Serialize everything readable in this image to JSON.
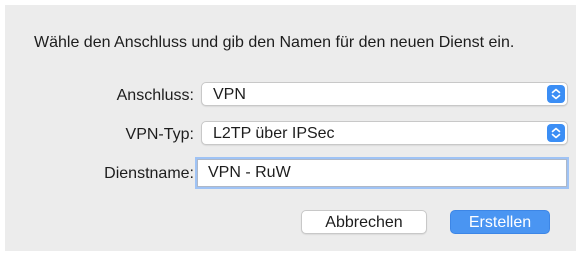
{
  "dialog": {
    "message": "Wähle den Anschluss und gib den Namen für den neuen Dienst ein.",
    "interface": {
      "label": "Anschluss:",
      "value": "VPN"
    },
    "vpn_type": {
      "label": "VPN-Typ:",
      "value": "L2TP über IPSec"
    },
    "service_name": {
      "label": "Dienstname:",
      "value": "VPN - RuW"
    },
    "buttons": {
      "cancel": "Abbrechen",
      "create": "Erstellen"
    }
  },
  "colors": {
    "accent": "#4a95f2",
    "dialog_background": "#ececec"
  },
  "icons": {
    "stepper": "chevron-up-down-icon"
  }
}
